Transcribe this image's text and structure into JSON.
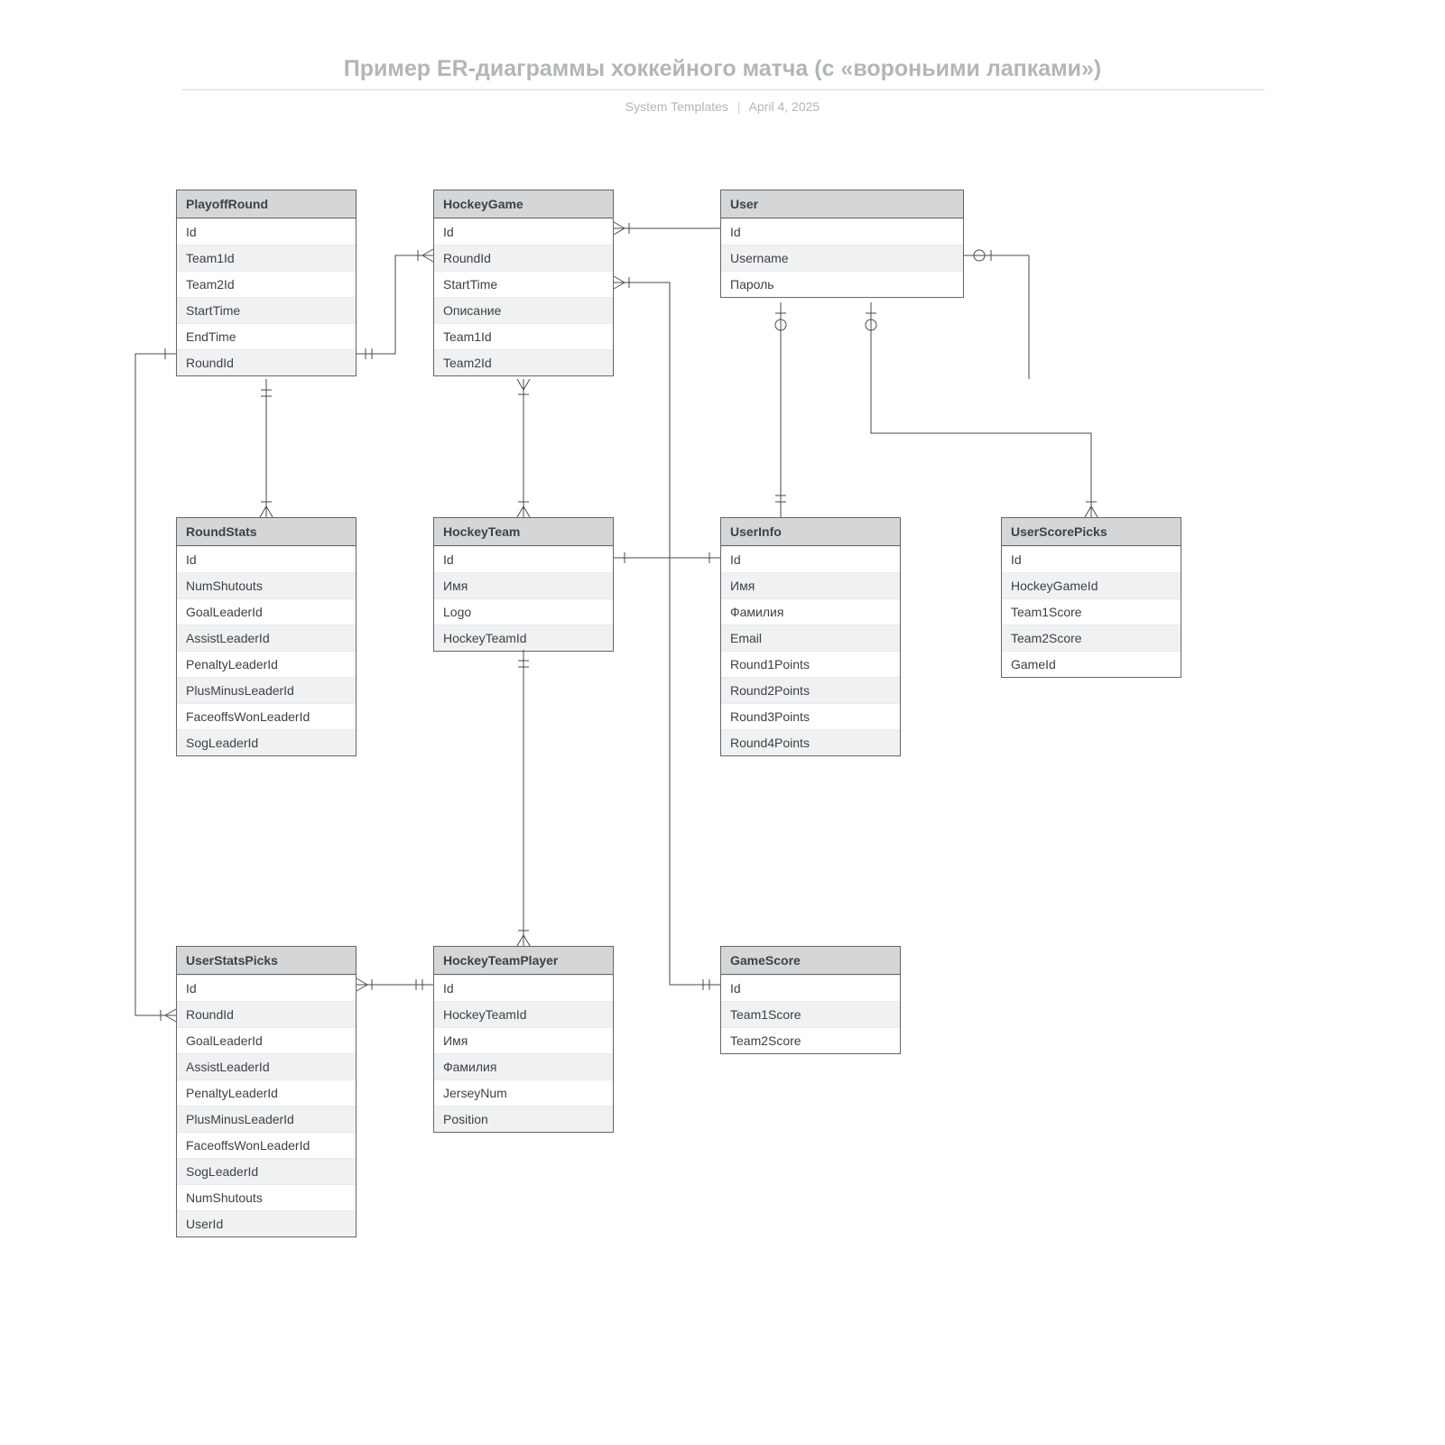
{
  "header": {
    "title": "Пример ER-диаграммы хоккейного матча (с «вороньими лапками»)",
    "subtitle_left": "System Templates",
    "subtitle_right": "April 4, 2025"
  },
  "entities": {
    "PlayoffRound": {
      "title": "PlayoffRound",
      "fields": [
        "Id",
        "Team1Id",
        "Team2Id",
        "StartTime",
        "EndTime",
        "RoundId"
      ]
    },
    "HockeyGame": {
      "title": "HockeyGame",
      "fields": [
        "Id",
        "RoundId",
        "StartTime",
        "Описание",
        "Team1Id",
        "Team2Id"
      ]
    },
    "User": {
      "title": "User",
      "fields": [
        "Id",
        "Username",
        "Пароль"
      ]
    },
    "RoundStats": {
      "title": "RoundStats",
      "fields": [
        "Id",
        "NumShutouts",
        "GoalLeaderId",
        "AssistLeaderId",
        "PenaltyLeaderId",
        "PlusMinusLeaderId",
        "FaceoffsWonLeaderId",
        "SogLeaderId"
      ]
    },
    "HockeyTeam": {
      "title": "HockeyTeam",
      "fields": [
        "Id",
        "Имя",
        "Logo",
        "HockeyTeamId"
      ]
    },
    "UserInfo": {
      "title": "UserInfo",
      "fields": [
        "Id",
        "Имя",
        "Фамилия",
        "Email",
        "Round1Points",
        "Round2Points",
        "Round3Points",
        "Round4Points"
      ]
    },
    "UserScorePicks": {
      "title": "UserScorePicks",
      "fields": [
        "Id",
        "HockeyGameId",
        "Team1Score",
        "Team2Score",
        "GameId"
      ]
    },
    "UserStatsPicks": {
      "title": "UserStatsPicks",
      "fields": [
        "Id",
        "RoundId",
        "GoalLeaderId",
        "AssistLeaderId",
        "PenaltyLeaderId",
        "PlusMinusLeaderId",
        "FaceoffsWonLeaderId",
        "SogLeaderId",
        "NumShutouts",
        "UserId"
      ]
    },
    "HockeyTeamPlayer": {
      "title": "HockeyTeamPlayer",
      "fields": [
        "Id",
        "HockeyTeamId",
        "Имя",
        "Фамилия",
        "JerseyNum",
        "Position"
      ]
    },
    "GameScore": {
      "title": "GameScore",
      "fields": [
        "Id",
        "Team1Score",
        "Team2Score"
      ]
    }
  },
  "relationships": [
    {
      "from": "PlayoffRound",
      "to": "HockeyGame",
      "type": "one-to-many"
    },
    {
      "from": "PlayoffRound",
      "to": "RoundStats",
      "type": "one-to-many"
    },
    {
      "from": "PlayoffRound",
      "to": "UserStatsPicks",
      "type": "one-to-many (via RoundId)"
    },
    {
      "from": "HockeyGame",
      "to": "HockeyTeam",
      "type": "many-to-one"
    },
    {
      "from": "HockeyGame",
      "to": "GameScore",
      "type": "one-to-one"
    },
    {
      "from": "HockeyGame",
      "to": "UserScorePicks",
      "type": "one-to-many"
    },
    {
      "from": "HockeyTeam",
      "to": "HockeyTeamPlayer",
      "type": "one-to-many"
    },
    {
      "from": "HockeyTeam",
      "to": "UserInfo",
      "type": "related"
    },
    {
      "from": "HockeyTeamPlayer",
      "to": "UserStatsPicks",
      "type": "one-to-many"
    },
    {
      "from": "User",
      "to": "UserInfo",
      "type": "one-to-one"
    },
    {
      "from": "User",
      "to": "UserScorePicks",
      "type": "one-to-many (optional)"
    },
    {
      "from": "User",
      "to": "UserStatsPicks",
      "type": "one-to-many (optional)"
    }
  ]
}
